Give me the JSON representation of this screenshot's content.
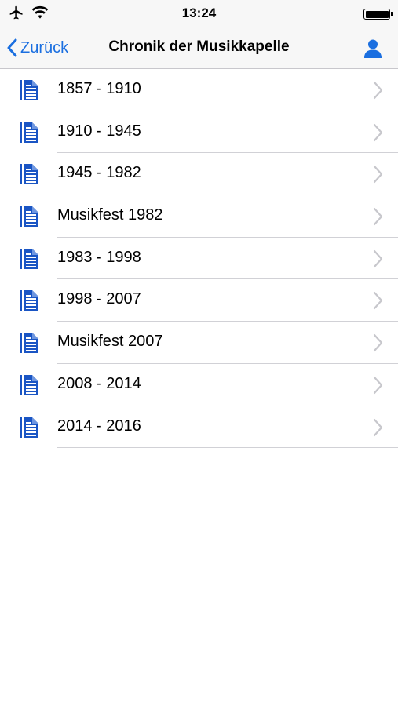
{
  "status_bar": {
    "time": "13:24",
    "icons": [
      "airplane-icon",
      "wifi-icon",
      "battery-icon"
    ]
  },
  "nav": {
    "back_label": "Zurück",
    "title": "Chronik der Musikkapelle",
    "right_icon": "person-icon"
  },
  "colors": {
    "accent": "#1b6fe0",
    "icon_blue": "#1a55c4",
    "chevron": "#c7c7cc",
    "separator": "#d1d1d6"
  },
  "items": [
    {
      "label": "1857 - 1910",
      "icon": "document-icon"
    },
    {
      "label": "1910 - 1945",
      "icon": "document-icon"
    },
    {
      "label": "1945 - 1982",
      "icon": "document-icon"
    },
    {
      "label": "Musikfest 1982",
      "icon": "document-icon"
    },
    {
      "label": "1983 - 1998",
      "icon": "document-icon"
    },
    {
      "label": "1998 - 2007",
      "icon": "document-icon"
    },
    {
      "label": "Musikfest 2007",
      "icon": "document-icon"
    },
    {
      "label": "2008 - 2014",
      "icon": "document-icon"
    },
    {
      "label": "2014 - 2016",
      "icon": "document-icon"
    }
  ]
}
